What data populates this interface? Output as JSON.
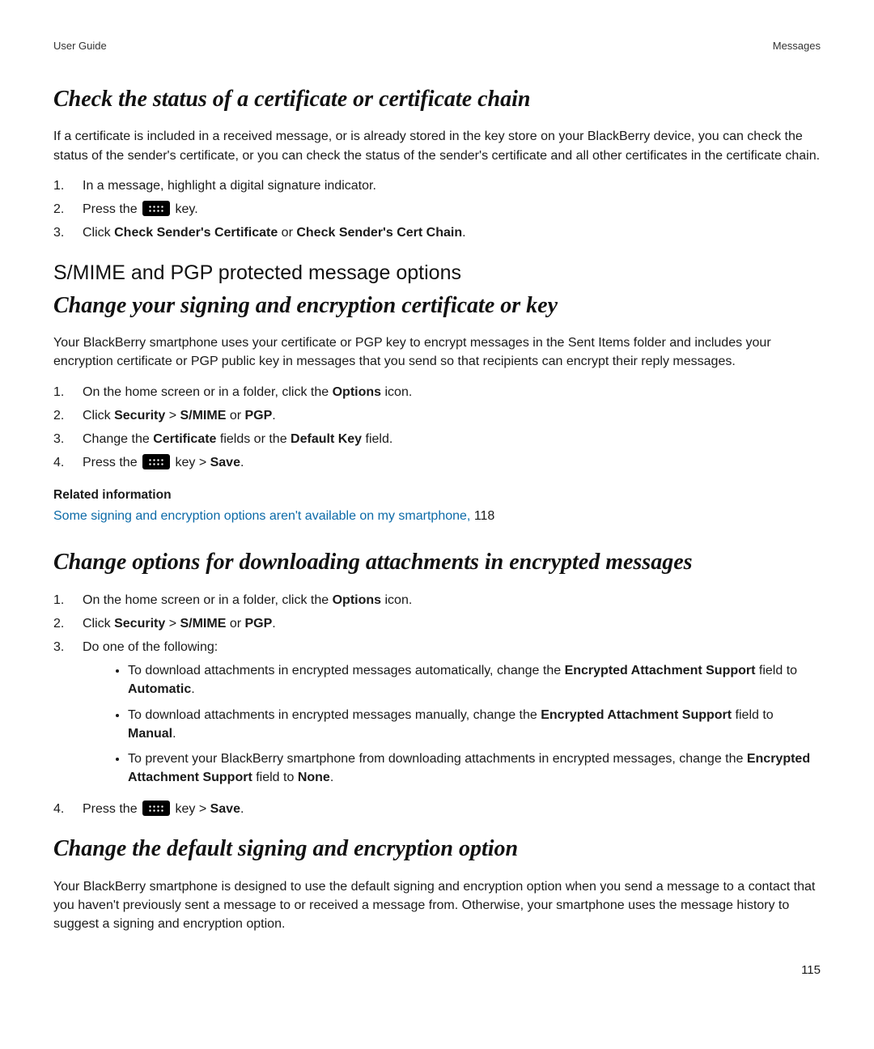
{
  "header": {
    "left": "User Guide",
    "right": "Messages"
  },
  "section1": {
    "heading": "Check the status of a certificate or certificate chain",
    "intro": "If a certificate is included in a received message, or is already stored in the key store on your BlackBerry device, you can check the status of the sender's certificate, or you can check the status of the sender's certificate and all other certificates in the certificate chain.",
    "steps": [
      {
        "num": "1.",
        "text": "In a message, highlight a digital signature indicator."
      },
      {
        "num": "2.",
        "prefix": "Press the ",
        "suffix": " key."
      },
      {
        "num": "3.",
        "prefix": "Click ",
        "b1": "Check Sender's Certificate",
        "mid": " or ",
        "b2": "Check Sender's Cert Chain",
        "suffix2": "."
      }
    ]
  },
  "section2": {
    "heading_plain": "S/MIME and PGP protected message options",
    "heading_italic": "Change your signing and encryption certificate or key",
    "intro": "Your BlackBerry smartphone uses your certificate or PGP key to encrypt messages in the Sent Items folder and includes your encryption certificate or PGP public key in messages that you send so that recipients can encrypt their reply messages.",
    "steps": [
      {
        "num": "1.",
        "prefix": "On the home screen or in a folder, click the ",
        "b1": "Options",
        "suffix": " icon."
      },
      {
        "num": "2.",
        "prefix": "Click ",
        "b1": "Security",
        "mid": " > ",
        "b2": "S/MIME",
        "mid2": " or ",
        "b3": "PGP",
        "suffix2": "."
      },
      {
        "num": "3.",
        "prefix": "Change the ",
        "b1": "Certificate",
        "mid": " fields or the ",
        "b2": "Default Key",
        "suffix2": " field."
      },
      {
        "num": "4.",
        "prefix": "Press the ",
        "mid": " key > ",
        "b2": "Save",
        "suffix2": "."
      }
    ],
    "related_heading": "Related information",
    "related_link": "Some signing and encryption options aren't available on my smartphone, ",
    "related_page": "118"
  },
  "section3": {
    "heading": "Change options for downloading attachments in encrypted messages",
    "steps": [
      {
        "num": "1.",
        "prefix": "On the home screen or in a folder, click the ",
        "b1": "Options",
        "suffix": " icon."
      },
      {
        "num": "2.",
        "prefix": "Click ",
        "b1": "Security",
        "mid": " > ",
        "b2": "S/MIME",
        "mid2": " or ",
        "b3": "PGP",
        "suffix2": "."
      },
      {
        "num": "3.",
        "text": "Do one of the following:"
      },
      {
        "num": "4.",
        "prefix": "Press the ",
        "mid": " key > ",
        "b2": "Save",
        "suffix2": "."
      }
    ],
    "bullets": [
      {
        "prefix": "To download attachments in encrypted messages automatically, change the ",
        "b1": "Encrypted Attachment Support",
        "mid": " field to ",
        "b2": "Automatic",
        "suffix": "."
      },
      {
        "prefix": "To download attachments in encrypted messages manually, change the ",
        "b1": "Encrypted Attachment Support",
        "mid": " field to ",
        "b2": "Manual",
        "suffix": "."
      },
      {
        "prefix": "To prevent your BlackBerry smartphone from downloading attachments in encrypted messages, change the ",
        "b1": "Encrypted Attachment Support",
        "mid": " field to ",
        "b2": "None",
        "suffix": "."
      }
    ]
  },
  "section4": {
    "heading": "Change the default signing and encryption option",
    "intro": "Your BlackBerry smartphone is designed to use the default signing and encryption option when you send a message to a contact that you haven't previously sent a message to or received a message from. Otherwise, your smartphone uses the message history to suggest a signing and encryption option."
  },
  "page_number": "115"
}
